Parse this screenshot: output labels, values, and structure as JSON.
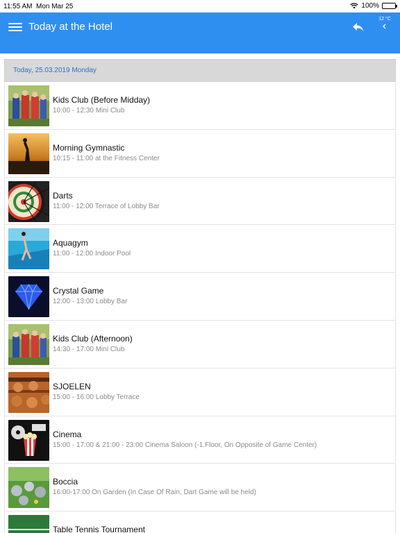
{
  "status_bar": {
    "time": "11:55 AM",
    "date": "Mon Mar 25",
    "battery": "100%"
  },
  "header": {
    "title": "Today at the Hotel",
    "weather_temp": "12 °C"
  },
  "date_label": "Today, 25.03.2019 Monday",
  "events": [
    {
      "name": "Kids Club (Before Midday)",
      "time": "10:00 - 12:30 Mini Club",
      "icon": "kids-club-photo"
    },
    {
      "name": "Morning Gymnastic",
      "time": "10:15 - 11:00 at the Fitness Center",
      "icon": "gymnastic-photo"
    },
    {
      "name": "Darts",
      "time": "11:00 - 12:00 Terrace of Lobby Bar",
      "icon": "dartboard-photo"
    },
    {
      "name": "Aquagym",
      "time": "11:00 - 12:00 Indoor Pool",
      "icon": "pool-photo"
    },
    {
      "name": "Crystal Game",
      "time": "12:00 - 13:00 Lobby Bar",
      "icon": "diamond-photo"
    },
    {
      "name": "Kids Club (Afternoon)",
      "time": "14:30 - 17:00 Mini Club",
      "icon": "kids-club-photo"
    },
    {
      "name": "SJOELEN",
      "time": "15:00 - 16:00 Lobby Terrace",
      "icon": "sjoelen-board-photo"
    },
    {
      "name": "Cinema",
      "time": "15:00 - 17:00 & 21:00 - 23:00 Cinema Saloon (-1.Floor, On Opposite of Game Center)",
      "icon": "cinema-popcorn-photo"
    },
    {
      "name": "Boccia",
      "time": "16:00-17:00 On Garden (In Case Of Rain, Dart Game will be held)",
      "icon": "boccia-balls-photo"
    },
    {
      "name": "Table Tennis Tournament",
      "time": "",
      "icon": "table-tennis-photo"
    }
  ]
}
